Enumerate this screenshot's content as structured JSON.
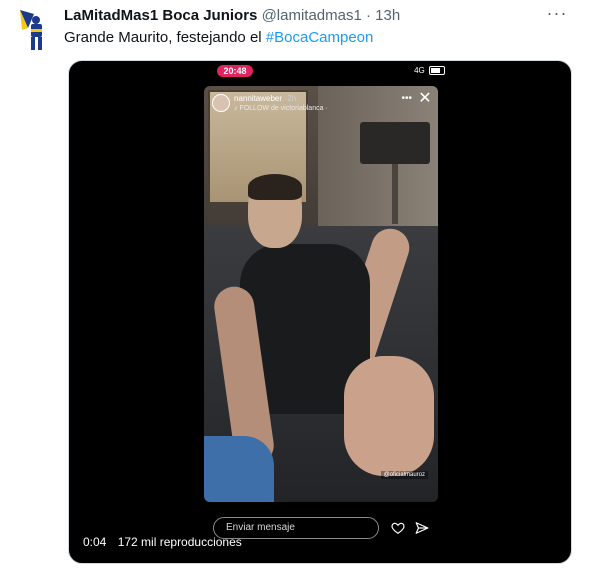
{
  "tweet": {
    "display_name": "LaMitadMas1 Boca Juniors",
    "handle": "@lamitadmas1",
    "separator": "·",
    "time": "13h",
    "more_label": "···",
    "text_prefix": "Grande Maurito, festejando el ",
    "hashtag": "#BocaCampeon"
  },
  "video": {
    "status_time": "20:48",
    "status_right": "4G",
    "story_user": "nannitaweber",
    "story_user_time": "2h",
    "story_subline": "♪ FOLLOW de victoriablanca ·",
    "story_tag": "@oficialmauroz",
    "message_placeholder": "Enviar mensaje",
    "elapsed": "0:04",
    "views": "172 mil reproducciones"
  },
  "colors": {
    "accent": "#1d9bf0",
    "text": "#0f1419",
    "muted": "#536471",
    "status_red": "#e0245e"
  },
  "icons": [
    "boca-juniors-avatar",
    "more-icon",
    "close-icon",
    "heart-icon",
    "send-icon"
  ]
}
